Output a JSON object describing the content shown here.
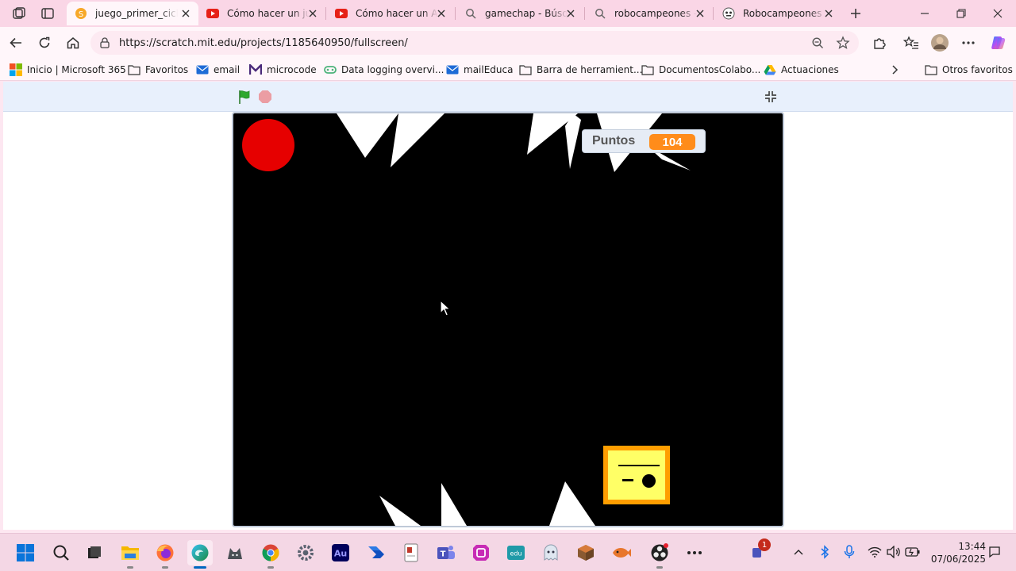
{
  "browser": {
    "tabs": [
      {
        "title": "juego_primer_ciclo",
        "icon": "scratch-icon",
        "active": true
      },
      {
        "title": "Cómo hacer un juego",
        "icon": "youtube-icon",
        "active": false
      },
      {
        "title": "Cómo hacer un Arkanoid",
        "icon": "youtube-icon",
        "active": false
      },
      {
        "title": "gamechap - Búsqueda",
        "icon": "search-icon",
        "active": false
      },
      {
        "title": "robocampeones - Búsqueda",
        "icon": "search-icon",
        "active": false
      },
      {
        "title": "Robocampeones - ",
        "icon": "robot-icon",
        "active": false
      }
    ],
    "url": "https://scratch.mit.edu/projects/1185640950/fullscreen/",
    "favorites": [
      {
        "label": "Inicio | Microsoft 365",
        "icon": "microsoft-icon"
      },
      {
        "label": "Favoritos",
        "icon": "folder-icon"
      },
      {
        "label": "email",
        "icon": "mail-icon"
      },
      {
        "label": "microcode",
        "icon": "microcode-icon"
      },
      {
        "label": "Data logging overvi...",
        "icon": "microbit-icon"
      },
      {
        "label": "mailEduca",
        "icon": "mail-icon"
      },
      {
        "label": "Barra de herramient...",
        "icon": "folder-icon"
      },
      {
        "label": "DocumentosColabo...",
        "icon": "folder-icon"
      },
      {
        "label": "Actuaciones",
        "icon": "drive-icon"
      }
    ],
    "other_favorites": "Otros favoritos"
  },
  "game": {
    "score_label": "Puntos",
    "score_value": "104",
    "colors": {
      "stage": "#000000",
      "ball": "#e60000",
      "player_fill": "#ffff66",
      "player_border": "#ff9e00",
      "monitor_value": "#ff8c1a",
      "green_flag": "#2ea82e",
      "stop": "#ec5959"
    }
  },
  "taskbar": {
    "apps": [
      "windows-start-icon",
      "search-icon",
      "task-view-icon",
      "file-explorer-icon",
      "firefox-icon",
      "edge-icon",
      "cat-app-icon",
      "chrome-icon",
      "settings-icon",
      "audition-icon",
      "power-automate-icon",
      "document-app-icon",
      "teams-icon",
      "app-icon",
      "educa-icon",
      "ghost-app-icon",
      "minecraft-icon",
      "fish-app-icon",
      "obs-icon",
      "more-icon"
    ],
    "notification_count": "1",
    "time": "13:44",
    "date": "07/06/2025"
  }
}
